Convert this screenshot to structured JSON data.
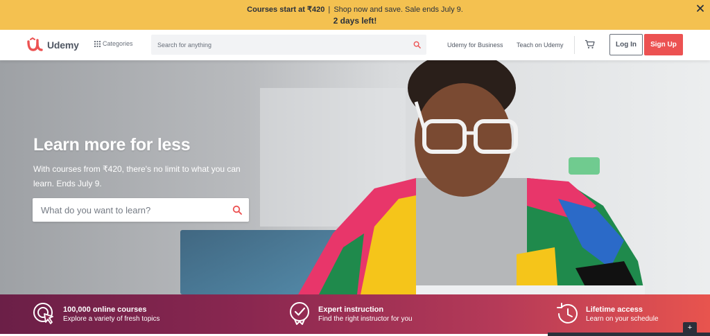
{
  "promo": {
    "headline": "Courses start at ₹420",
    "separator": "|",
    "details": "Shop now and save. Sale ends July 9.",
    "countdown": "2 days left!",
    "close_icon": "close-icon"
  },
  "header": {
    "logo_text": "Udemy",
    "categories_label": "Categories",
    "search_placeholder": "Search for anything",
    "business_link": "Udemy for Business",
    "teach_link": "Teach on Udemy",
    "login_label": "Log In",
    "signup_label": "Sign Up"
  },
  "hero": {
    "title": "Learn more for less",
    "subtitle": "With courses from ₹420, there's no limit to what you can learn. Ends July 9.",
    "search_placeholder": "What do you want to learn?"
  },
  "features": [
    {
      "title": "100,000 online courses",
      "desc": "Explore a variety of fresh topics",
      "icon": "target-cursor-icon"
    },
    {
      "title": "Expert instruction",
      "desc": "Find the right instructor for you",
      "icon": "badge-check-icon"
    },
    {
      "title": "Lifetime access",
      "desc": "Learn on your schedule",
      "icon": "clock-history-icon"
    }
  ],
  "floating": {
    "label": "+"
  },
  "colors": {
    "promo_bg": "#f4c150",
    "brand_red": "#ec5252",
    "text_dark": "#29303b",
    "feature_gradient_start": "#6b1f47",
    "feature_gradient_end": "#e8544e"
  }
}
